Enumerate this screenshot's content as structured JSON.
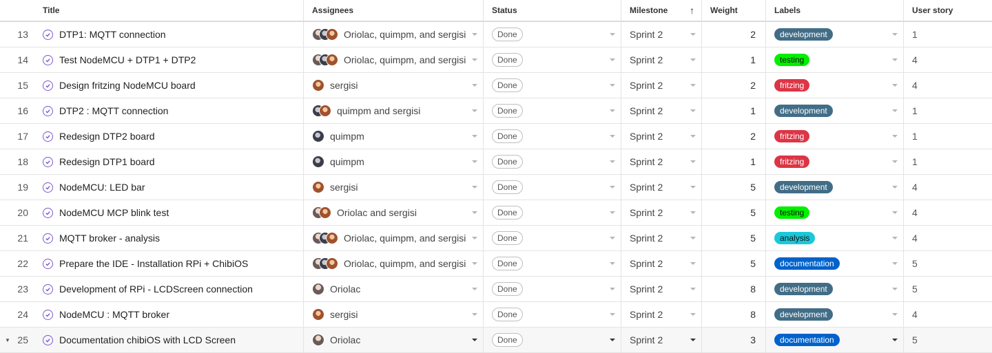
{
  "columns": {
    "title": "Title",
    "assignees": "Assignees",
    "status": "Status",
    "milestone": "Milestone",
    "weight": "Weight",
    "labels": "Labels",
    "user_story": "User story"
  },
  "label_colors": {
    "development": "#426d87",
    "testing": "#00f000",
    "fritzing": "#dc3545",
    "analysis": "#1ac8db",
    "documentation": "#0063cc"
  },
  "rows": [
    {
      "num": "13",
      "title": "DTP1: MQTT connection",
      "assignees": "Oriolac, quimpm, and sergisi",
      "avatars": [
        "o",
        "q",
        "s"
      ],
      "status": "Done",
      "milestone": "Sprint 2",
      "weight": "2",
      "label": "development",
      "story": "1"
    },
    {
      "num": "14",
      "title": "Test NodeMCU + DTP1 + DTP2",
      "assignees": "Oriolac, quimpm, and sergisi",
      "avatars": [
        "o",
        "q",
        "s"
      ],
      "status": "Done",
      "milestone": "Sprint 2",
      "weight": "1",
      "label": "testing",
      "story": "4"
    },
    {
      "num": "15",
      "title": "Design fritzing NodeMCU board",
      "assignees": "sergisi",
      "avatars": [
        "s"
      ],
      "status": "Done",
      "milestone": "Sprint 2",
      "weight": "2",
      "label": "fritzing",
      "story": "4"
    },
    {
      "num": "16",
      "title": "DTP2 : MQTT connection",
      "assignees": "quimpm and sergisi",
      "avatars": [
        "q",
        "s"
      ],
      "status": "Done",
      "milestone": "Sprint 2",
      "weight": "1",
      "label": "development",
      "story": "1"
    },
    {
      "num": "17",
      "title": "Redesign DTP2 board",
      "assignees": "quimpm",
      "avatars": [
        "q"
      ],
      "status": "Done",
      "milestone": "Sprint 2",
      "weight": "2",
      "label": "fritzing",
      "story": "1"
    },
    {
      "num": "18",
      "title": "Redesign DTP1 board",
      "assignees": "quimpm",
      "avatars": [
        "q"
      ],
      "status": "Done",
      "milestone": "Sprint 2",
      "weight": "1",
      "label": "fritzing",
      "story": "1"
    },
    {
      "num": "19",
      "title": "NodeMCU: LED bar",
      "assignees": "sergisi",
      "avatars": [
        "s"
      ],
      "status": "Done",
      "milestone": "Sprint 2",
      "weight": "5",
      "label": "development",
      "story": "4"
    },
    {
      "num": "20",
      "title": "NodeMCU MCP blink test",
      "assignees": "Oriolac and sergisi",
      "avatars": [
        "o",
        "s"
      ],
      "status": "Done",
      "milestone": "Sprint 2",
      "weight": "5",
      "label": "testing",
      "story": "4"
    },
    {
      "num": "21",
      "title": "MQTT broker - analysis",
      "assignees": "Oriolac, quimpm, and sergisi",
      "avatars": [
        "o",
        "q",
        "s"
      ],
      "status": "Done",
      "milestone": "Sprint 2",
      "weight": "5",
      "label": "analysis",
      "story": "4"
    },
    {
      "num": "22",
      "title": "Prepare the IDE - Installation RPi + ChibiOS",
      "assignees": "Oriolac, quimpm, and sergisi",
      "avatars": [
        "o",
        "q",
        "s"
      ],
      "status": "Done",
      "milestone": "Sprint 2",
      "weight": "5",
      "label": "documentation",
      "story": "5"
    },
    {
      "num": "23",
      "title": "Development of RPi - LCDScreen connection",
      "assignees": "Oriolac",
      "avatars": [
        "o"
      ],
      "status": "Done",
      "milestone": "Sprint 2",
      "weight": "8",
      "label": "development",
      "story": "5"
    },
    {
      "num": "24",
      "title": "NodeMCU : MQTT broker",
      "assignees": "sergisi",
      "avatars": [
        "s"
      ],
      "status": "Done",
      "milestone": "Sprint 2",
      "weight": "8",
      "label": "development",
      "story": "4"
    },
    {
      "num": "25",
      "title": "Documentation chibiOS with LCD Screen",
      "assignees": "Oriolac",
      "avatars": [
        "o"
      ],
      "status": "Done",
      "milestone": "Sprint 2",
      "weight": "3",
      "label": "documentation",
      "story": "5"
    }
  ]
}
